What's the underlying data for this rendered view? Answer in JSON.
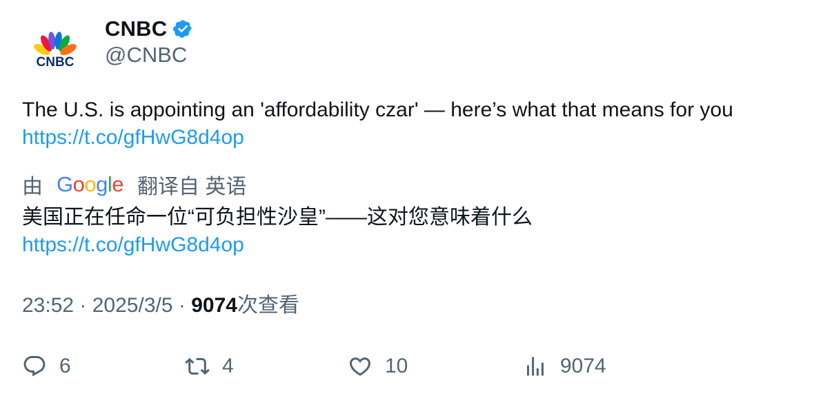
{
  "tweet": {
    "author": {
      "display_name": "CNBC",
      "handle": "@CNBC",
      "verified": true,
      "avatar_label": "CNBC",
      "verified_color": "#1d9bf0"
    },
    "text": "The U.S. is appointing an 'affordability czar' — here’s what that means for you",
    "link": "https://t.co/gfHwG8d4op",
    "translation": {
      "prefix": "由",
      "provider": "Google",
      "suffix": "翻译自 英语",
      "text": "美国正在任命一位“可负担性沙皇”——这对您意味着什么",
      "link": "https://t.co/gfHwG8d4op"
    },
    "meta": {
      "time": "23:52",
      "separator": " · ",
      "date": "2025/3/5",
      "views_count": "9074",
      "views_label": "次查看"
    },
    "actions": {
      "reply": {
        "icon": "reply-icon",
        "count": "6"
      },
      "retweet": {
        "icon": "retweet-icon",
        "count": "4"
      },
      "like": {
        "icon": "heart-icon",
        "count": "10"
      },
      "views": {
        "icon": "views-chart-icon",
        "count": "9074"
      }
    },
    "colors": {
      "text": "#0f1419",
      "secondary": "#536471",
      "link": "#1d9bf0"
    }
  }
}
